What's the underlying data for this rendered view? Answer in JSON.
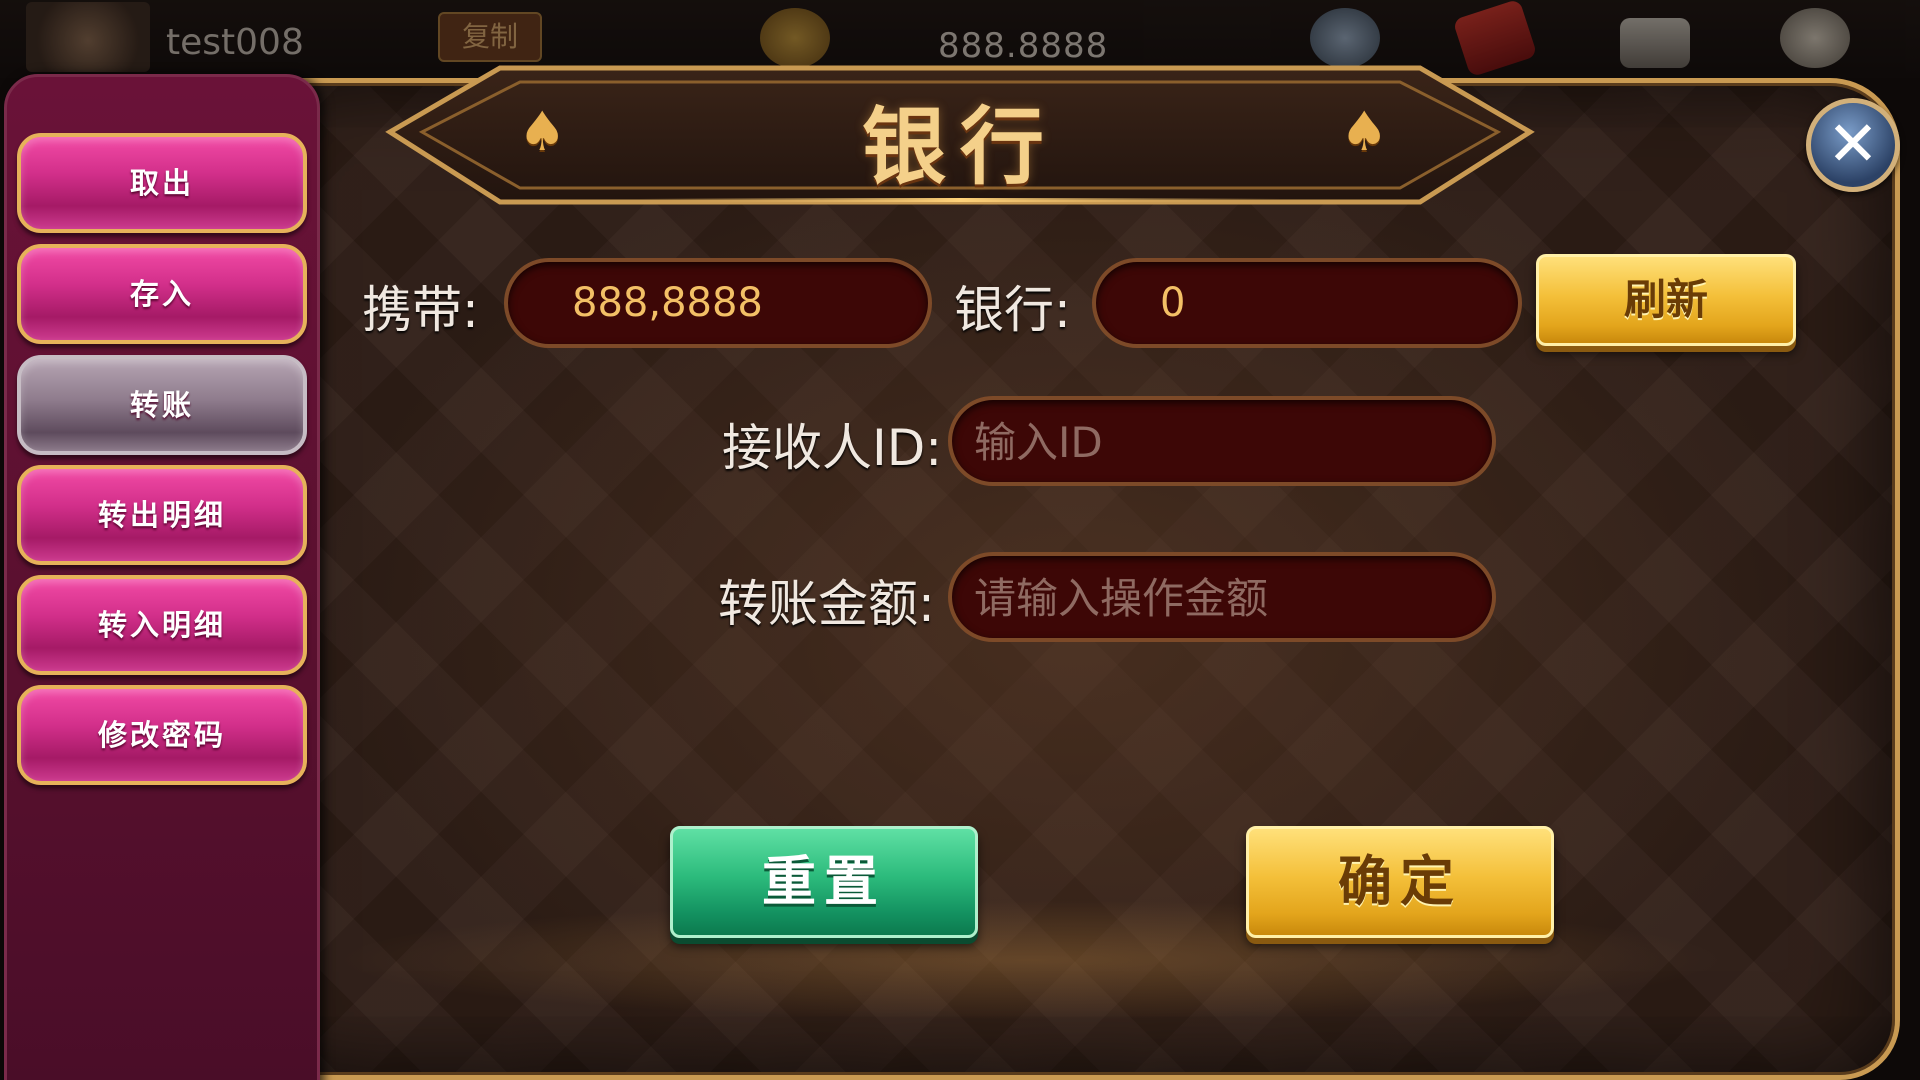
{
  "top_bar": {
    "username": "test008",
    "copy_label": "复制",
    "gold_value": "888.8888"
  },
  "title": "银行",
  "sidebar": {
    "items": [
      {
        "label": "取出",
        "active": false
      },
      {
        "label": "存入",
        "active": false
      },
      {
        "label": "转账",
        "active": true
      },
      {
        "label": "转出明细",
        "active": false
      },
      {
        "label": "转入明细",
        "active": false
      },
      {
        "label": "修改密码",
        "active": false
      }
    ]
  },
  "form": {
    "carry_label": "携带:",
    "carry_value": "888,8888",
    "bank_label": "银行:",
    "bank_value": "0",
    "refresh_label": "刷新",
    "recipient_label": "接收人ID:",
    "recipient_placeholder": "输入ID",
    "amount_label": "转账金额:",
    "amount_placeholder": "请输入操作金额"
  },
  "actions": {
    "reset_label": "重置",
    "confirm_label": "确定"
  },
  "colors": {
    "accent_gold": "#f4c03a",
    "frame_gold": "#c99a52",
    "sidebar_magenta": "#d22f8a",
    "field_bg": "#3d0706",
    "reset_green": "#2cbb7c"
  }
}
